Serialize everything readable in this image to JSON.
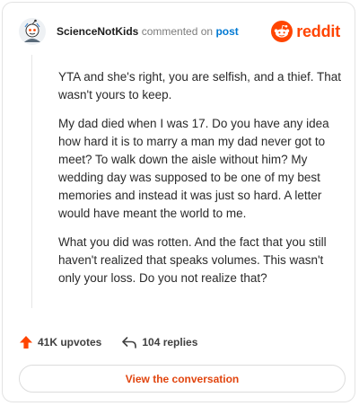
{
  "header": {
    "username": "ScienceNotKids",
    "verb": "commented on",
    "post_link": "post",
    "avatar_icon": "snoo-avatar-icon",
    "brand_icon": "reddit-logo-icon",
    "brand_word": "reddit"
  },
  "comment": {
    "paragraphs": [
      "YTA and she's right, you are selfish, and a thief. That wasn't yours to keep.",
      "My dad died when I was 17. Do you have any idea how hard it is to marry a man my dad never got to meet? To walk down the aisle without him? My wedding day was supposed to be one of my best memories and instead it was just so hard. A letter would have meant the world to me.",
      "What you did was rotten. And the fact that you still haven't realized that speaks volumes. This wasn't only your loss. Do you not realize that?"
    ]
  },
  "stats": {
    "upvotes": "41K upvotes",
    "replies": "104 replies",
    "upvote_icon": "upvote-arrow-icon",
    "reply_icon": "reply-arrow-icon"
  },
  "cta": {
    "label": "View the conversation"
  },
  "colors": {
    "brand": "#ff4500",
    "link": "#0079d3",
    "upvote": "#ff4500",
    "cta_text": "#e1450f"
  }
}
